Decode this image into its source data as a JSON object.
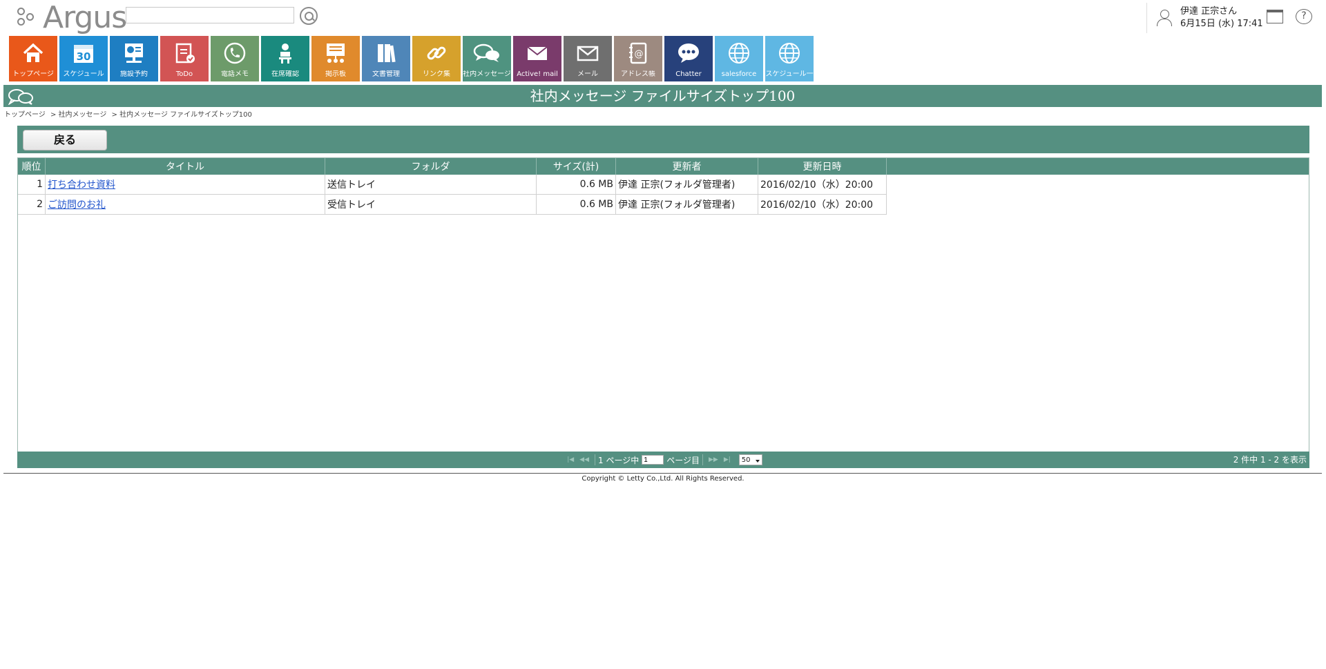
{
  "app": {
    "logo_text": "Argus"
  },
  "search": {
    "value": "",
    "placeholder": ""
  },
  "user": {
    "name": "伊達 正宗さん",
    "datetime": "6月15日 (水) 17:41"
  },
  "nav": [
    {
      "label": "トップページ",
      "icon": "home-icon",
      "color": "#e9581a"
    },
    {
      "label": "スケジュール",
      "icon": "calendar-icon",
      "glyph": "30",
      "color": "#1f8fd6"
    },
    {
      "label": "施設予約",
      "icon": "facility-icon",
      "color": "#1e7ec2"
    },
    {
      "label": "ToDo",
      "icon": "todo-icon",
      "color": "#d25454"
    },
    {
      "label": "電話メモ",
      "icon": "phone-icon",
      "color": "#6d9b6a"
    },
    {
      "label": "在席確認",
      "icon": "presence-icon",
      "color": "#1a8a7e"
    },
    {
      "label": "掲示板",
      "icon": "board-icon",
      "color": "#e08a2c"
    },
    {
      "label": "文書管理",
      "icon": "document-icon",
      "color": "#4f86b8"
    },
    {
      "label": "リンク集",
      "icon": "link-icon",
      "color": "#d6a12c"
    },
    {
      "label": "社内メッセージ",
      "icon": "message-icon",
      "color": "#4f9380"
    },
    {
      "label": "Active! mail",
      "icon": "active-mail-icon",
      "color": "#7a3b6b"
    },
    {
      "label": "メール",
      "icon": "mail-icon",
      "color": "#6f6f6f"
    },
    {
      "label": "アドレス帳",
      "icon": "address-book-icon",
      "color": "#9d8a80"
    },
    {
      "label": "Chatter",
      "icon": "chatter-icon",
      "color": "#27417b"
    },
    {
      "label": "salesforce",
      "icon": "globe-icon",
      "color": "#5fb7e3"
    },
    {
      "label": "スケジュール一",
      "icon": "globe-icon",
      "color": "#5fb7e3"
    }
  ],
  "page": {
    "title": "社内メッセージ ファイルサイズトップ100"
  },
  "breadcrumb": [
    "トップページ",
    "> 社内メッセージ",
    "> 社内メッセージ ファイルサイズトップ100"
  ],
  "toolbar": {
    "back_label": "戻る"
  },
  "table": {
    "headers": [
      "順位",
      "タイトル",
      "フォルダ",
      "サイズ(計)",
      "更新者",
      "更新日時"
    ],
    "rows": [
      {
        "rank": "1",
        "title": "打ち合わせ資料",
        "folder": "送信トレイ",
        "size": "0.6 MB",
        "updater": "伊達 正宗(フォルダ管理者)",
        "updated": "2016/02/10（水）20:00"
      },
      {
        "rank": "2",
        "title": "ご訪問のお礼",
        "folder": "受信トレイ",
        "size": "0.6 MB",
        "updater": "伊達 正宗(フォルダ管理者)",
        "updated": "2016/02/10（水）20:00"
      }
    ]
  },
  "pager": {
    "page_prefix": "1 ページ中",
    "page_value": "1",
    "page_suffix": "ページ目",
    "per_page": "50",
    "count": "2 件中 1 - 2 を表示"
  },
  "footer": {
    "copyright": "Copyright © Letty Co.,Ltd. All Rights Reserved."
  }
}
